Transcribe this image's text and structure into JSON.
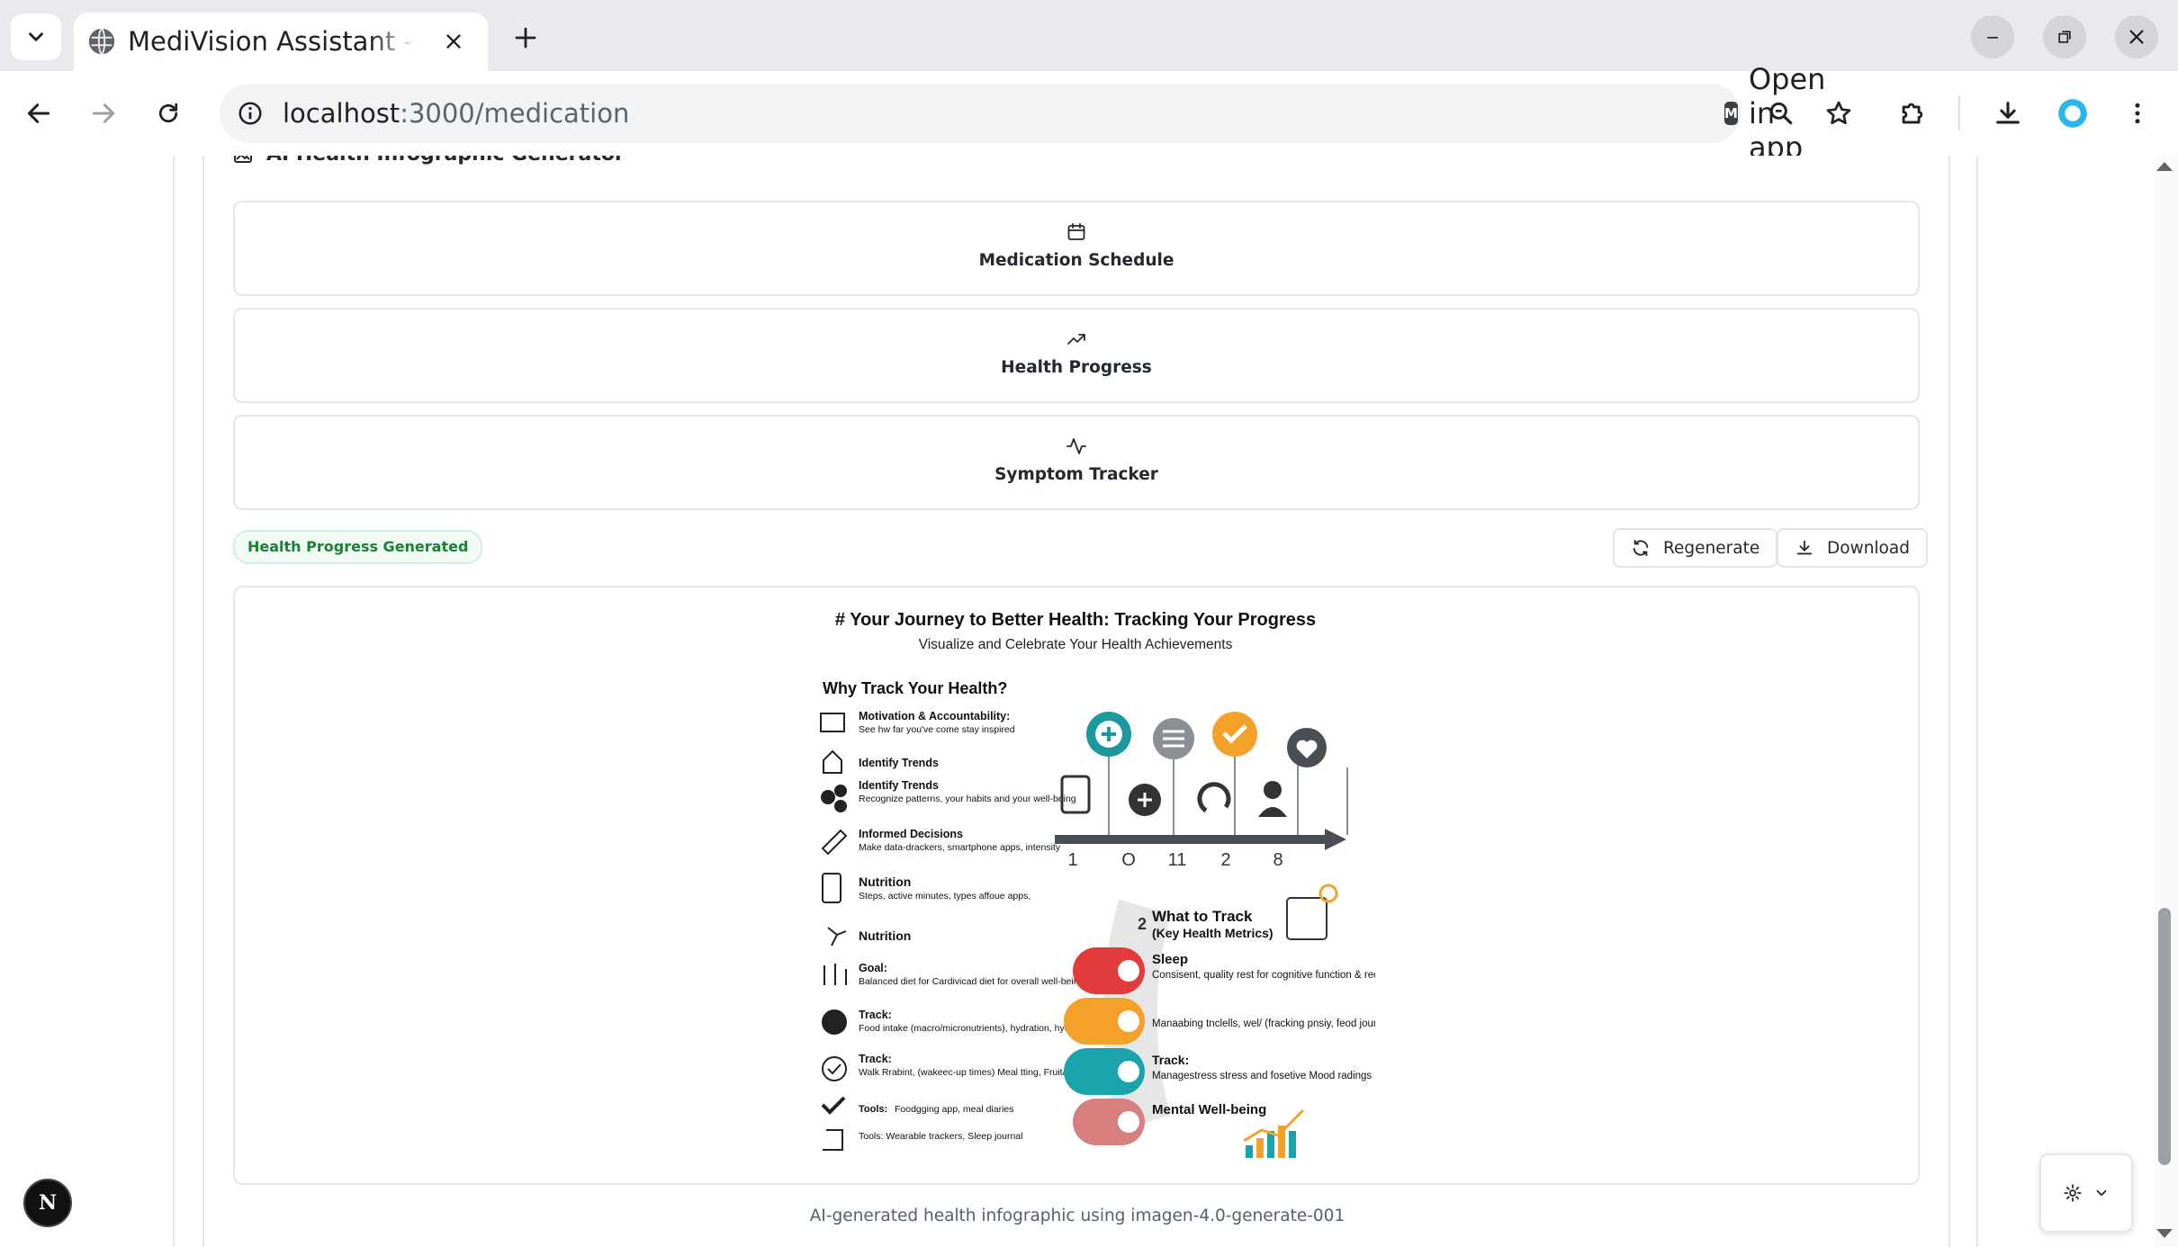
{
  "browser": {
    "tab": {
      "title": "MediVision Assistant - AI Healthcare"
    },
    "address": {
      "host": "localhost",
      "path": ":3000/medication"
    },
    "open_in_app": {
      "badge": "M",
      "label": "Open in app"
    }
  },
  "page": {
    "card_heading": "AI Health Infographic Generator",
    "options": [
      {
        "label": "Medication Schedule",
        "icon": "calendar-icon"
      },
      {
        "label": "Health Progress",
        "icon": "trending-up-icon"
      },
      {
        "label": "Symptom Tracker",
        "icon": "activity-icon"
      }
    ],
    "status_badge": "Health Progress Generated",
    "actions": {
      "regenerate": "Regenerate",
      "download": "Download"
    },
    "caption": "AI-generated health infographic using imagen-4.0-generate-001"
  },
  "infographic": {
    "title": "# Your Journey to Better Health: Tracking Your Progress",
    "subtitle": "Visualize and Celebrate Your Health Achievements",
    "left_heading": "Why Track Your Health?",
    "left_items": [
      {
        "title": "Motivation & Accountability:",
        "desc": "See hw far you've come stay inspired"
      },
      {
        "title": "Identify Trends",
        "desc": ""
      },
      {
        "title": "Identify Trends",
        "desc": "Recognize patterns, your habits and your well-being"
      },
      {
        "title": "Informed Decisions",
        "desc": "Make data-drackers, smartphone apps, intensity"
      },
      {
        "title": "Nutrition",
        "desc": "Steps, active minutes, types affoue apps,"
      },
      {
        "title": "Nutrition",
        "desc": ""
      },
      {
        "title": "Goal:",
        "desc": "Balanced diet for Cardivicad diet for overall well-being."
      },
      {
        "title": "Track:",
        "desc": "Food intake (macro/micronutrients), hydration, hydration"
      },
      {
        "title": "Track:",
        "desc": "Walk Rrabint, (wakeec-up times) Meal tting, Fruit/ftetable servings"
      },
      {
        "title": "Tools:",
        "desc": "Foodgging app, meal diaries"
      },
      {
        "title": "",
        "desc": "Tools: Wearable trackers, Sleep journal"
      }
    ],
    "timeline_labels": [
      "1",
      "O",
      "11",
      "2",
      "8"
    ],
    "track_heading": "What to Track",
    "track_subheading": "(Key Health Metrics)",
    "track_number": "2",
    "track_items": [
      {
        "title": "Sleep",
        "desc": "Consisent, quality rest for cognitive function & recovery.",
        "color": "#e23b3b"
      },
      {
        "title": "",
        "desc": "Manaabing tnclells, wel/ (fracking pnsiy, feod journal",
        "color": "#f4a12a"
      },
      {
        "title": "Track:",
        "desc": "Managestress stress and fosetive Mood radings",
        "color": "#1aa3aa"
      },
      {
        "title": "Mental Well-being",
        "desc": "",
        "color": "#d77f7f"
      }
    ],
    "colors": {
      "teal": "#1a9aa0",
      "orange": "#f4a12a",
      "gray": "#8a8f95",
      "dark": "#4a4f55"
    }
  }
}
